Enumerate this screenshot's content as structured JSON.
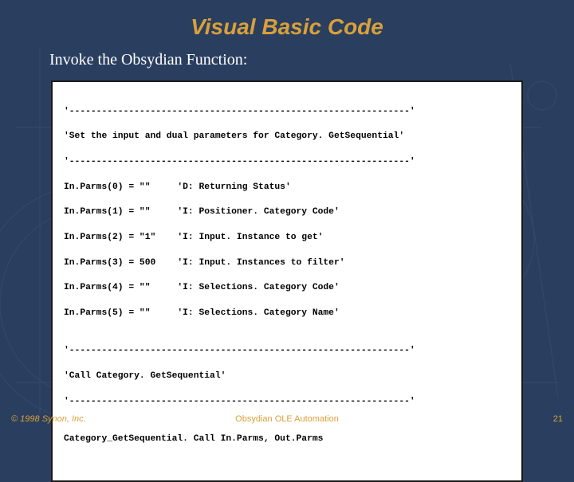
{
  "slide": {
    "title": "Visual Basic Code",
    "subtitle": "Invoke the Obsydian Function:"
  },
  "code": {
    "lines": [
      "'---------------------------------------------------------------'",
      "'Set the input and dual parameters for Category. GetSequential'",
      "'---------------------------------------------------------------'",
      "In.Parms(0) = \"\"     'D: Returning Status'",
      "In.Parms(1) = \"\"     'I: Positioner. Category Code'",
      "In.Parms(2) = \"1\"    'I: Input. Instance to get'",
      "In.Parms(3) = 500    'I: Input. Instances to filter'",
      "In.Parms(4) = \"\"     'I: Selections. Category Code'",
      "In.Parms(5) = \"\"     'I: Selections. Category Name'",
      "",
      "'---------------------------------------------------------------'",
      "'Call Category. GetSequential'",
      "'---------------------------------------------------------------'",
      "",
      "Category_GetSequential. Call In.Parms, Out.Parms"
    ]
  },
  "footer": {
    "copyright": "© 1998 Synon, Inc.",
    "center": "Obsydian OLE Automation",
    "page": "21"
  }
}
